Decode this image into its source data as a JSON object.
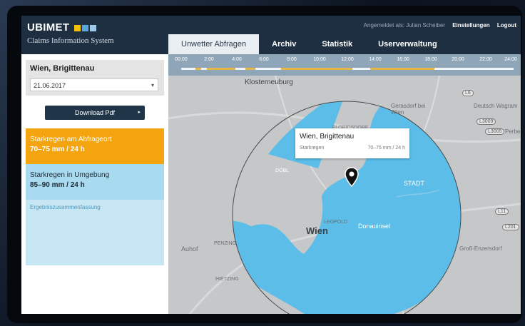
{
  "app": {
    "brand": "UBIMET",
    "subtitle": "Claims Information System",
    "brand_colors": [
      "#f2c200",
      "#5aa7dc",
      "#9ec9ea"
    ]
  },
  "header": {
    "logged_in": "Angemeldet als: Julian Scheiber",
    "settings": "Einstellungen",
    "logout": "Logout",
    "tabs": [
      {
        "label": "Unwetter Abfragen",
        "active": true
      },
      {
        "label": "Archiv",
        "active": false
      },
      {
        "label": "Statistik",
        "active": false
      },
      {
        "label": "Userverwaltung",
        "active": false
      }
    ]
  },
  "sidebar": {
    "location": "Wien, Brigittenau",
    "date": "21.06.2017",
    "download_label": "Download Pdf",
    "results": [
      {
        "label": "Starkregen am Abfrageort",
        "value": "70–75 mm / 24 h",
        "color": "#f3a40f"
      },
      {
        "label": "Starkregen in Umgebung",
        "value": "85–90 mm / 24 h",
        "color": "#a8dbef"
      }
    ],
    "summary_link": "Ergebniszusammenfassung"
  },
  "timeline": {
    "ticks": [
      "00:00",
      "2:00",
      "4:00",
      "6:00",
      "8:00",
      "10:00",
      "12:00",
      "14:00",
      "16:00",
      "18:00",
      "20:00",
      "22:00",
      "24:00"
    ]
  },
  "map": {
    "labels": {
      "klosterneuburg": "Klosterneuburg",
      "gerasdorf": "Gerasdorf bei Wien",
      "deutsch_wagram": "Deutsch Wagram",
      "floridsdorf": "FLORIDSDORF",
      "wien": "Wien",
      "donauinsel": "Donauinsel",
      "auhof": "Auhof",
      "penzing": "PENZING",
      "hietzing": "HIETZING",
      "gross_enzersdorf": "Groß-Enzersdorf",
      "stadt": "STADT",
      "dobl": "DÖBL",
      "leopold": "LEOPOLD",
      "perbe": "Perbe"
    },
    "badges": [
      "L6",
      "L3009",
      "L3005",
      "L11",
      "L201"
    ],
    "popup": {
      "title": "Wien, Brigittenau",
      "label": "Starkregen",
      "value": "70–75 mm / 24 h"
    },
    "rain_color": "#5bbde8"
  }
}
